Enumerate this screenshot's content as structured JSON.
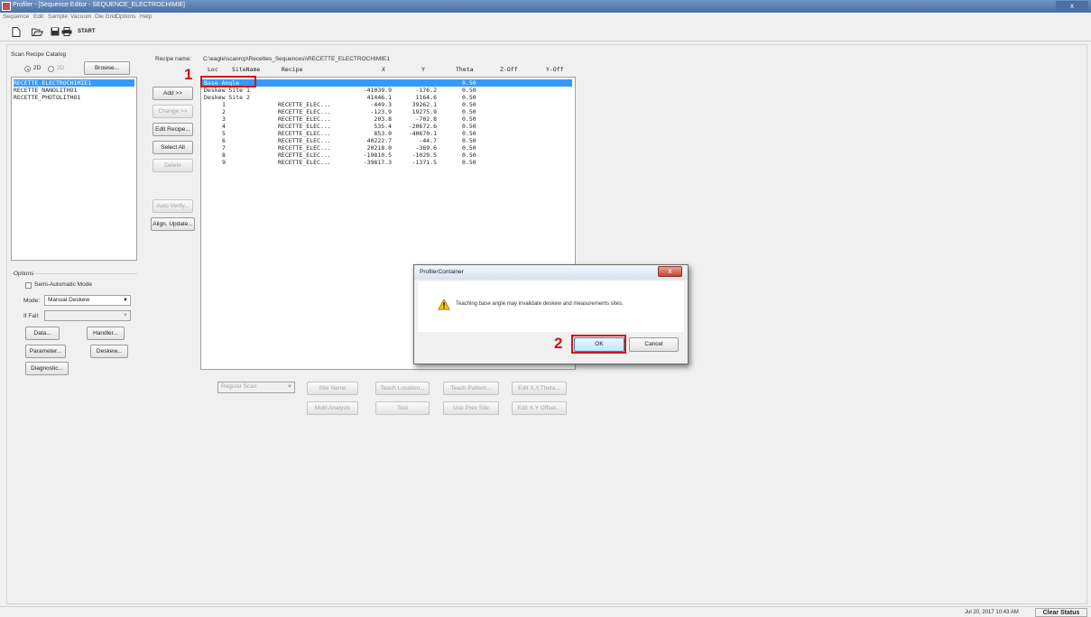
{
  "window": {
    "title": "Profiler - [Sequence Editor - SEQUENCE_ELECTROCHIMIE]",
    "close_glyph": "x"
  },
  "menu": [
    "Sequence",
    "Edit",
    "Sample",
    "Vacuum",
    "Die Grid",
    "Options",
    "Help"
  ],
  "toolbar": {
    "icons": [
      "new-file-icon",
      "open-folder-icon",
      "save-icon",
      "print-icon"
    ],
    "start_label": "START"
  },
  "catalog": {
    "title": "Scan Recipe Catalog",
    "radio_2d": "2D",
    "radio_3d": "3D",
    "browse_label": "Browse...",
    "items": [
      "RECETTE_ELECTROCHIMIE1",
      "RECETTE_NANOLITHO1",
      "RECETTE_PHOTOLITHO1"
    ]
  },
  "options": {
    "title": "Options",
    "semi_auto_label": "Semi-Automatic Mode",
    "mode_label": "Mode:",
    "mode_value": "Manual Deskew",
    "iffail_label": "If Fail:",
    "iffail_value": "",
    "buttons": {
      "data": "Data...",
      "handler": "Handler...",
      "parameter": "Parameter...",
      "deskew": "Deskew...",
      "diagnostic": "Diagnostic..."
    }
  },
  "middle_buttons": {
    "add": "Add >>",
    "change": "Change >>",
    "edit_recipe": "Edit Recipe...",
    "select_all": "Select All",
    "delete": "Delete",
    "auto_verify": "Auto Verify...",
    "align_update": "Align. Update..."
  },
  "recipe": {
    "name_label": "Recipe name:",
    "path": "C:\\eagle\\scanrcp\\Recettes_Sequences\\\\RECETTE_ELECTROCHIMIE1",
    "columns": [
      "Loc",
      "SiteName",
      "Recipe",
      "X",
      "Y",
      "Theta",
      "Z-Off",
      "Y-Off"
    ],
    "rows": [
      {
        "loc": "Base Angle",
        "recipe": "",
        "x": "",
        "y": "",
        "theta": "0.50"
      },
      {
        "loc": "Deskew Site 1",
        "recipe": "",
        "x": "-41039.9",
        "y": "-176.2",
        "theta": "0.50"
      },
      {
        "loc": "Deskew Site 2",
        "recipe": "",
        "x": "41446.1",
        "y": "1164.6",
        "theta": "0.50"
      },
      {
        "loc": "1",
        "recipe": "RECETTE_ELEC...",
        "x": "-449.3",
        "y": "39262.1",
        "theta": "0.50"
      },
      {
        "loc": "2",
        "recipe": "RECETTE_ELEC...",
        "x": "-123.9",
        "y": "19275.9",
        "theta": "0.50"
      },
      {
        "loc": "3",
        "recipe": "RECETTE_ELEC...",
        "x": "203.8",
        "y": "-702.8",
        "theta": "0.50"
      },
      {
        "loc": "4",
        "recipe": "RECETTE_ELEC...",
        "x": "535.4",
        "y": "-20672.6",
        "theta": "0.50"
      },
      {
        "loc": "5",
        "recipe": "RECETTE_ELEC...",
        "x": "853.0",
        "y": "-40670.1",
        "theta": "0.50"
      },
      {
        "loc": "6",
        "recipe": "RECETTE_ELEC...",
        "x": "40222.7",
        "y": "-44.7",
        "theta": "0.50"
      },
      {
        "loc": "7",
        "recipe": "RECETTE_ELEC...",
        "x": "20218.0",
        "y": "-369.6",
        "theta": "0.50"
      },
      {
        "loc": "8",
        "recipe": "RECETTE_ELEC...",
        "x": "-19810.5",
        "y": "-1029.5",
        "theta": "0.50"
      },
      {
        "loc": "9",
        "recipe": "RECETTE_ELEC...",
        "x": "-39817.3",
        "y": "-1371.5",
        "theta": "0.50"
      }
    ]
  },
  "bottom": {
    "scan_type": "Regular Scan",
    "site_name": "Site Name",
    "teach_location": "Teach Location...",
    "teach_pattern": "Teach Pattern...",
    "edit_xy_theta": "Edit X,Y,Theta...",
    "multi_analysis": "Multi Analysis",
    "test": "Test",
    "use_prev_site": "Use Prev Site",
    "edit_xy_offset": "Edit X,Y Offset..."
  },
  "dialog": {
    "title": "ProfilerContainer",
    "close_glyph": "x",
    "message": "Teaching base angle may invalidate deskew and measurements sites.",
    "ok": "OK",
    "cancel": "Cancel"
  },
  "annotations": {
    "one": "1",
    "two": "2"
  },
  "status": {
    "datetime": "Jul 20, 2017 10:43 AM",
    "clear_label": "Clear Status"
  },
  "colors": {
    "selection": "#3399ff",
    "annotation_red": "#d0131b",
    "titlebar": "#4a6fa5"
  }
}
